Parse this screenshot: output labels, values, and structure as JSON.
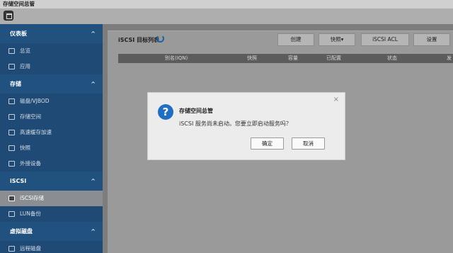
{
  "window": {
    "title": "存储空间总管"
  },
  "sidebar": {
    "sections": [
      {
        "label": "仪表板",
        "items": [
          {
            "label": "总览"
          },
          {
            "label": "应用"
          }
        ]
      },
      {
        "label": "存储",
        "items": [
          {
            "label": "磁盘/VJBOD"
          },
          {
            "label": "存储空间"
          },
          {
            "label": "高速缓存加速"
          },
          {
            "label": "快照"
          },
          {
            "label": "外接设备"
          }
        ]
      },
      {
        "label": "iSCSI",
        "items": [
          {
            "label": "iSCSI存储"
          },
          {
            "label": "LUN备份"
          }
        ]
      },
      {
        "label": "虚拟磁盘",
        "items": [
          {
            "label": "远程磁盘"
          }
        ]
      }
    ],
    "active_item": "iSCSI存储"
  },
  "main": {
    "panel_title": "iSCSI 目标列表",
    "buttons": {
      "create": "创建",
      "snapshot": "快照▾",
      "iscsi_acl": "iSCSI ACL",
      "settings": "设置"
    },
    "table_headers": [
      "别名(IQN)",
      "快照",
      "容量",
      "已配置",
      "状态",
      "发"
    ]
  },
  "dialog": {
    "title": "存储空间总管",
    "message": "iSCSI 服务尚未启动。您要立即启动服务吗？",
    "confirm": "确定",
    "cancel": "取消",
    "close_symbol": "×",
    "icon_glyph": "?"
  },
  "colors": {
    "accent": "#1e6fc4",
    "sidebar": "#17324f",
    "sidebar_section": "#21527f"
  }
}
